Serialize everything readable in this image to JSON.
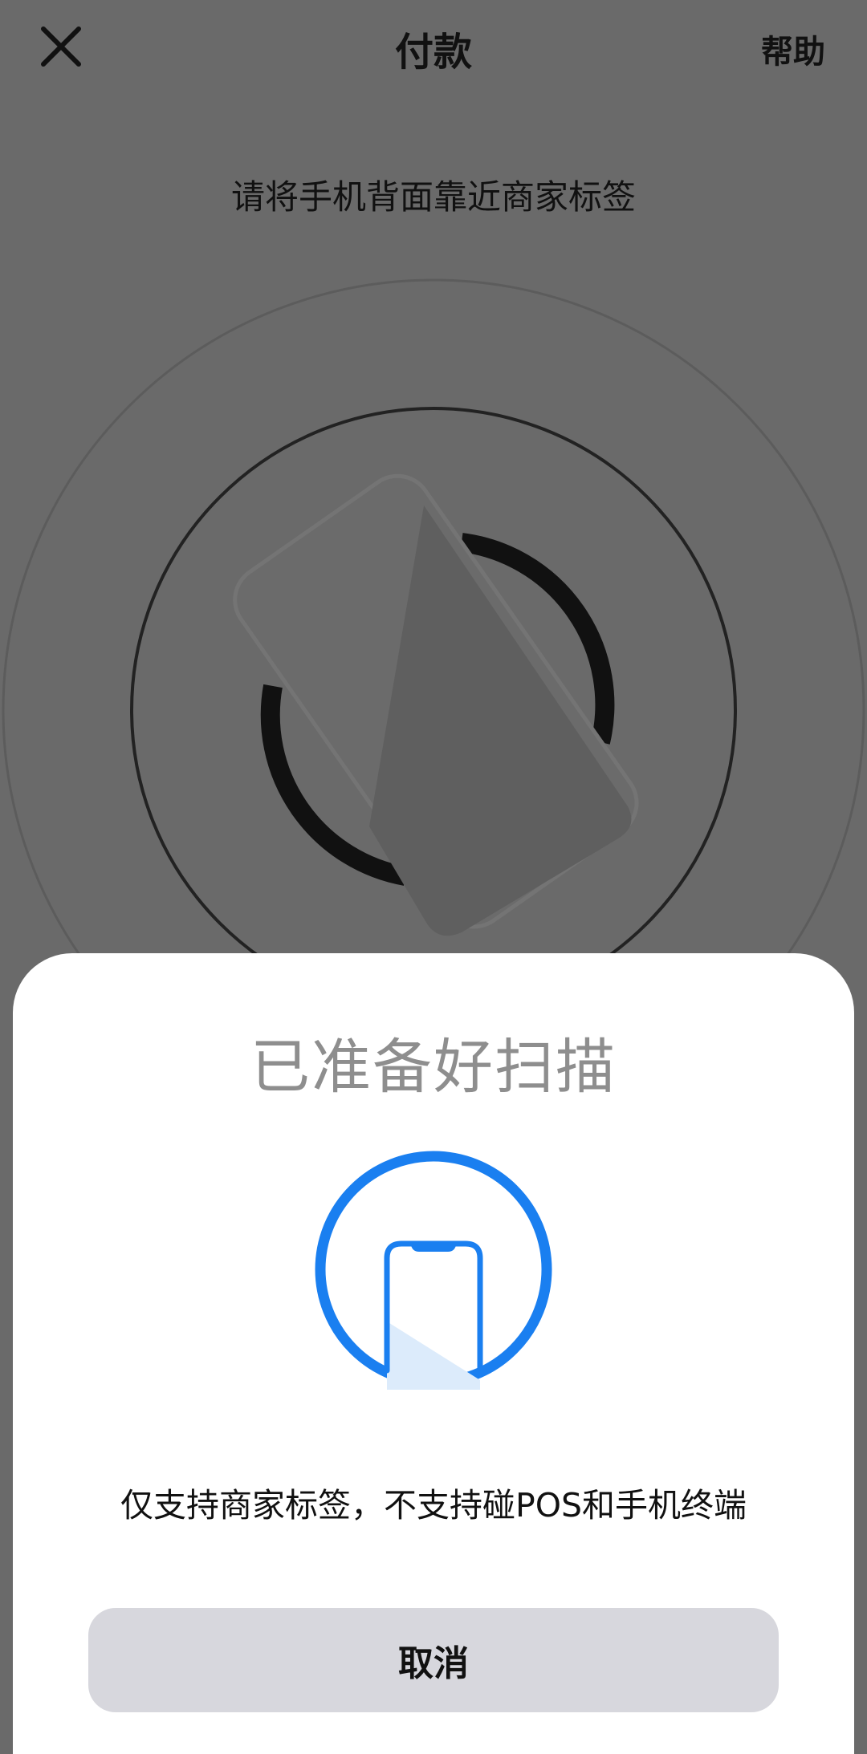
{
  "header": {
    "title": "付款",
    "help_label": "帮助",
    "close_icon": "close-icon"
  },
  "instruction": "请将手机背面靠近商家标签",
  "sheet": {
    "title": "已准备好扫描",
    "notice": "仅支持商家标签，不支持碰POS和手机终端",
    "cancel_label": "取消",
    "icon": "phone-nfc-icon"
  },
  "colors": {
    "overlay_background": "#6a6a6a",
    "accent_blue": "#1a7ff0",
    "cancel_button_bg": "#d7d7dd",
    "sheet_title_gray": "#8e8e8e"
  }
}
